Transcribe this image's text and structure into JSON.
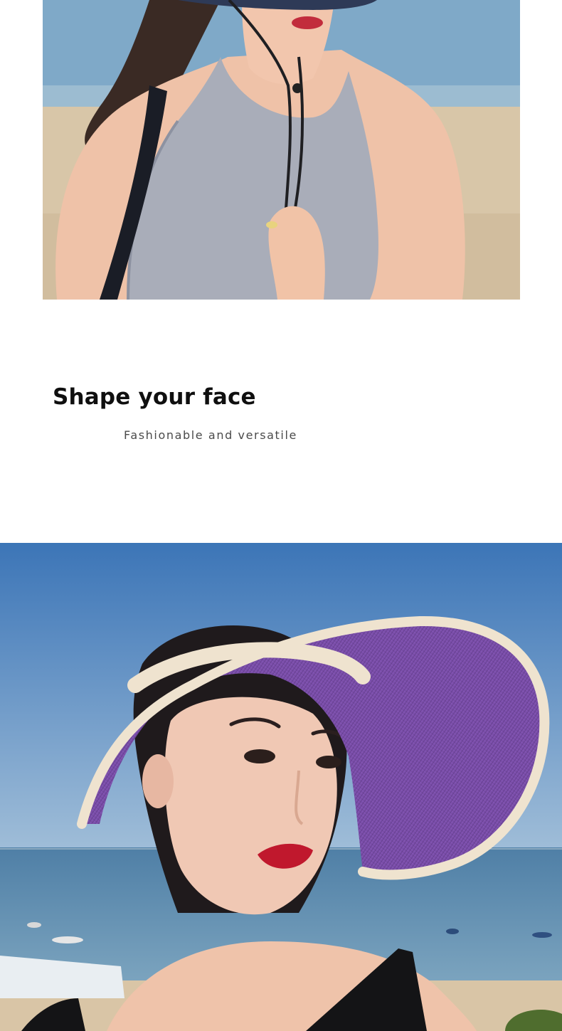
{
  "headline": {
    "title": "Shape your face",
    "subtitle": "Fashionable and versatile"
  },
  "photos": {
    "top": {
      "icon": "beach-model-tank-top-photo"
    },
    "bottom": {
      "icon": "beach-model-visor-hat-photo"
    }
  },
  "colors": {
    "headline": "#0f0f0f",
    "subline": "#4a4a4a",
    "visor_purple": "#7a4fa8",
    "visor_trim": "#efe3cf",
    "sky": "#4f84bf",
    "sea": "#5c8fb5",
    "sand": "#d6c4a6"
  }
}
